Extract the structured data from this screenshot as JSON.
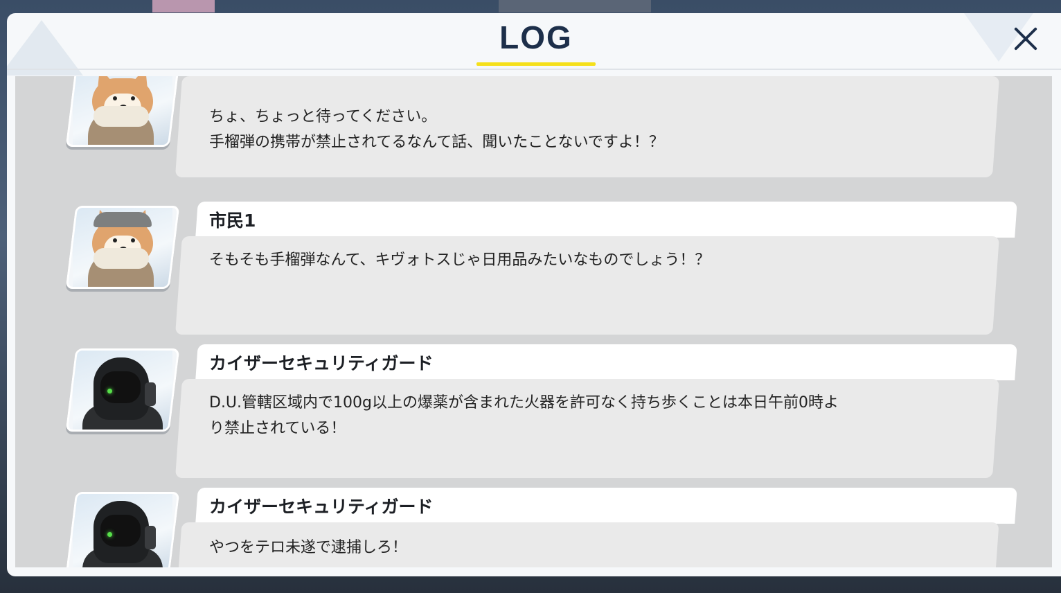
{
  "header": {
    "title": "LOG",
    "close_icon": "close-icon"
  },
  "entries": [
    {
      "avatar": "corgi-citizen",
      "name": "",
      "lines": [
        "ちょ、ちょっと待ってください。",
        "手榴弾の携帯が禁止されてるなんて話、聞いたことないですよ！？"
      ]
    },
    {
      "avatar": "corgi-citizen",
      "name": "市民1",
      "lines": [
        "そもそも手榴弾なんて、キヴォトスじゃ日用品みたいなものでしょう！？"
      ]
    },
    {
      "avatar": "kaiser-security-guard",
      "name": "カイザーセキュリティガード",
      "lines": [
        "D.U.管轄区域内で100g以上の爆薬が含まれた火器を許可なく持ち歩くことは本日午前0時よ",
        "り禁止されている！"
      ]
    },
    {
      "avatar": "kaiser-security-guard",
      "name": "カイザーセキュリティガード",
      "lines": [
        "やつをテロ未遂で逮捕しろ！"
      ]
    }
  ],
  "colors": {
    "title": "#1d2f4a",
    "underline": "#f5e01a",
    "bubble": "#eaeaea",
    "log_bg": "#d4d5d6"
  }
}
